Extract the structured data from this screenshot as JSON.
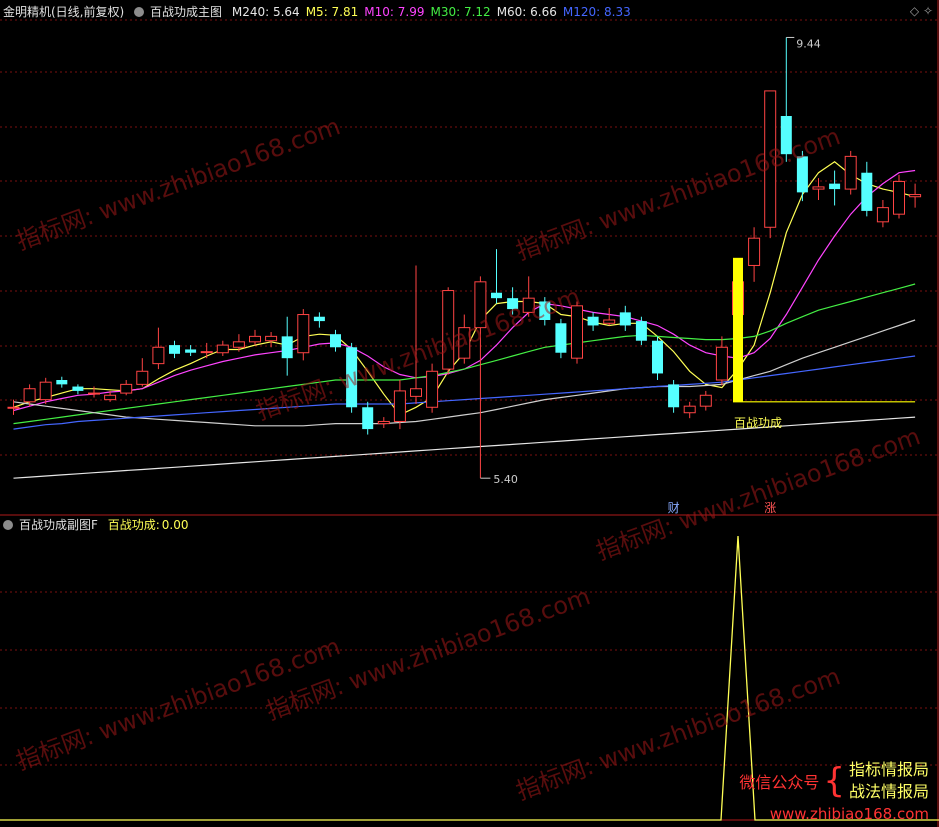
{
  "main_panel": {
    "title": "金明精机(日线,前复权)",
    "indicator_name": "百战功成主图",
    "ma_values": [
      {
        "label": "M240",
        "value": "5.64",
        "color": "#e6e6e6"
      },
      {
        "label": "M5",
        "value": "7.81",
        "color": "#ffff55"
      },
      {
        "label": "M10",
        "value": "7.99",
        "color": "#ff44ff"
      },
      {
        "label": "M30",
        "value": "7.12",
        "color": "#44ee44"
      },
      {
        "label": "M60",
        "value": "6.66",
        "color": "#e6e6e6"
      },
      {
        "label": "M120",
        "value": "8.33",
        "color": "#4466ff"
      }
    ],
    "high_label": "9.44",
    "low_label": "5.40",
    "signal_label": "百战功成",
    "marker_cai": "财",
    "marker_zhang": "涨"
  },
  "sub_panel": {
    "title": "百战功成副图F",
    "indicator_label": "百战功成:",
    "indicator_value": "0.00"
  },
  "watermark": {
    "domain_text": "www.zhibiao168.com",
    "brand_text": "指标网:"
  },
  "promo": {
    "wechat_label": "微信公众号",
    "line1": "指标情报局",
    "line2": "战法情报局",
    "url": "www.zhibiao168.com"
  },
  "colors": {
    "up": "#ff4444",
    "down": "#55ffff",
    "grid": "#7a1010",
    "signal_bar": "#ffff00"
  },
  "chart_data": {
    "type": "candlestick",
    "ylim": [
      5.2,
      9.6
    ],
    "candles": [
      {
        "o": 6.05,
        "c": 6.05,
        "h": 6.12,
        "l": 5.98
      },
      {
        "o": 6.1,
        "c": 6.22,
        "h": 6.26,
        "l": 6.06
      },
      {
        "o": 6.12,
        "c": 6.28,
        "h": 6.32,
        "l": 6.08
      },
      {
        "o": 6.3,
        "c": 6.26,
        "h": 6.33,
        "l": 6.23
      },
      {
        "o": 6.24,
        "c": 6.2,
        "h": 6.26,
        "l": 6.17
      },
      {
        "o": 6.18,
        "c": 6.18,
        "h": 6.24,
        "l": 6.14
      },
      {
        "o": 6.12,
        "c": 6.16,
        "h": 6.2,
        "l": 6.1
      },
      {
        "o": 6.18,
        "c": 6.26,
        "h": 6.3,
        "l": 6.16
      },
      {
        "o": 6.26,
        "c": 6.38,
        "h": 6.5,
        "l": 6.24
      },
      {
        "o": 6.45,
        "c": 6.6,
        "h": 6.78,
        "l": 6.4
      },
      {
        "o": 6.62,
        "c": 6.54,
        "h": 6.66,
        "l": 6.5
      },
      {
        "o": 6.58,
        "c": 6.55,
        "h": 6.62,
        "l": 6.52
      },
      {
        "o": 6.56,
        "c": 6.56,
        "h": 6.64,
        "l": 6.5
      },
      {
        "o": 6.55,
        "c": 6.62,
        "h": 6.66,
        "l": 6.52
      },
      {
        "o": 6.6,
        "c": 6.65,
        "h": 6.72,
        "l": 6.56
      },
      {
        "o": 6.65,
        "c": 6.7,
        "h": 6.76,
        "l": 6.62
      },
      {
        "o": 6.66,
        "c": 6.7,
        "h": 6.74,
        "l": 6.6
      },
      {
        "o": 6.7,
        "c": 6.5,
        "h": 6.88,
        "l": 6.34
      },
      {
        "o": 6.55,
        "c": 6.9,
        "h": 6.95,
        "l": 6.48
      },
      {
        "o": 6.88,
        "c": 6.84,
        "h": 6.92,
        "l": 6.78
      },
      {
        "o": 6.72,
        "c": 6.6,
        "h": 6.76,
        "l": 6.56
      },
      {
        "o": 6.6,
        "c": 6.05,
        "h": 6.64,
        "l": 6.0
      },
      {
        "o": 6.05,
        "c": 5.85,
        "h": 6.1,
        "l": 5.8
      },
      {
        "o": 5.9,
        "c": 5.92,
        "h": 5.96,
        "l": 5.86
      },
      {
        "o": 5.92,
        "c": 6.2,
        "h": 6.3,
        "l": 5.85
      },
      {
        "o": 6.15,
        "c": 6.22,
        "h": 7.35,
        "l": 6.08
      },
      {
        "o": 6.05,
        "c": 6.38,
        "h": 6.45,
        "l": 6.0
      },
      {
        "o": 6.4,
        "c": 7.12,
        "h": 7.15,
        "l": 6.35
      },
      {
        "o": 6.5,
        "c": 6.78,
        "h": 6.9,
        "l": 6.45
      },
      {
        "o": 6.78,
        "c": 7.2,
        "h": 7.25,
        "l": 5.4
      },
      {
        "o": 7.1,
        "c": 7.05,
        "h": 7.5,
        "l": 7.0
      },
      {
        "o": 7.05,
        "c": 6.95,
        "h": 7.15,
        "l": 6.9
      },
      {
        "o": 6.92,
        "c": 7.05,
        "h": 7.25,
        "l": 6.88
      },
      {
        "o": 7.02,
        "c": 6.85,
        "h": 7.06,
        "l": 6.8
      },
      {
        "o": 6.82,
        "c": 6.55,
        "h": 6.86,
        "l": 6.5
      },
      {
        "o": 6.5,
        "c": 6.98,
        "h": 7.02,
        "l": 6.45
      },
      {
        "o": 6.88,
        "c": 6.8,
        "h": 6.92,
        "l": 6.75
      },
      {
        "o": 6.82,
        "c": 6.85,
        "h": 6.96,
        "l": 6.8
      },
      {
        "o": 6.92,
        "c": 6.8,
        "h": 6.98,
        "l": 6.75
      },
      {
        "o": 6.84,
        "c": 6.66,
        "h": 6.88,
        "l": 6.62
      },
      {
        "o": 6.66,
        "c": 6.36,
        "h": 6.7,
        "l": 6.3
      },
      {
        "o": 6.26,
        "c": 6.05,
        "h": 6.3,
        "l": 6.0
      },
      {
        "o": 6.0,
        "c": 6.06,
        "h": 6.1,
        "l": 5.95
      },
      {
        "o": 6.06,
        "c": 6.16,
        "h": 6.2,
        "l": 6.02
      },
      {
        "o": 6.3,
        "c": 6.6,
        "h": 6.7,
        "l": 6.25
      },
      {
        "o": 6.9,
        "c": 7.2,
        "h": 7.3,
        "l": 6.85
      },
      {
        "o": 7.35,
        "c": 7.6,
        "h": 7.7,
        "l": 7.2
      },
      {
        "o": 7.7,
        "c": 8.95,
        "h": 8.95,
        "l": 7.6
      },
      {
        "o": 8.72,
        "c": 8.37,
        "h": 9.44,
        "l": 8.3
      },
      {
        "o": 8.35,
        "c": 8.02,
        "h": 8.4,
        "l": 7.94
      },
      {
        "o": 8.05,
        "c": 8.07,
        "h": 8.15,
        "l": 7.95
      },
      {
        "o": 8.1,
        "c": 8.05,
        "h": 8.22,
        "l": 7.9
      },
      {
        "o": 8.05,
        "c": 8.35,
        "h": 8.4,
        "l": 8.0
      },
      {
        "o": 8.2,
        "c": 7.85,
        "h": 8.3,
        "l": 7.8
      },
      {
        "o": 7.75,
        "c": 7.88,
        "h": 7.95,
        "l": 7.7
      },
      {
        "o": 7.82,
        "c": 8.12,
        "h": 8.18,
        "l": 7.78
      },
      {
        "o": 7.98,
        "c": 8.0,
        "h": 8.1,
        "l": 7.88
      }
    ],
    "ma_lines": {
      "M5": [
        6.05,
        6.1,
        6.14,
        6.18,
        6.22,
        6.22,
        6.21,
        6.2,
        6.22,
        6.31,
        6.39,
        6.45,
        6.52,
        6.58,
        6.58,
        6.62,
        6.65,
        6.62,
        6.7,
        6.72,
        6.71,
        6.58,
        6.38,
        6.17,
        5.98,
        6.05,
        6.14,
        6.38,
        6.55,
        6.85,
        7.0,
        7.02,
        7.02,
        7.0,
        6.9,
        6.88,
        6.83,
        6.8,
        6.82,
        6.82,
        6.7,
        6.56,
        6.38,
        6.26,
        6.23,
        6.4,
        6.62,
        7.1,
        7.65,
        8.0,
        8.2,
        8.3,
        8.18,
        8.1,
        8.05,
        8.02,
        7.98
      ],
      "M10": [
        6.02,
        6.06,
        6.1,
        6.13,
        6.16,
        6.17,
        6.19,
        6.2,
        6.22,
        6.28,
        6.34,
        6.39,
        6.43,
        6.47,
        6.5,
        6.53,
        6.55,
        6.57,
        6.6,
        6.63,
        6.64,
        6.6,
        6.52,
        6.42,
        6.35,
        6.32,
        6.33,
        6.36,
        6.4,
        6.48,
        6.62,
        6.78,
        6.92,
        7.0,
        6.98,
        6.95,
        6.92,
        6.9,
        6.88,
        6.84,
        6.8,
        6.72,
        6.62,
        6.55,
        6.52,
        6.5,
        6.55,
        6.68,
        6.9,
        7.15,
        7.4,
        7.62,
        7.82,
        7.98,
        8.1,
        8.2,
        8.22
      ],
      "M30": [
        5.9,
        5.92,
        5.94,
        5.96,
        5.98,
        6.0,
        6.02,
        6.04,
        6.06,
        6.08,
        6.1,
        6.12,
        6.14,
        6.16,
        6.18,
        6.2,
        6.22,
        6.24,
        6.26,
        6.28,
        6.3,
        6.3,
        6.3,
        6.3,
        6.3,
        6.32,
        6.34,
        6.37,
        6.4,
        6.44,
        6.48,
        6.52,
        6.56,
        6.6,
        6.62,
        6.64,
        6.66,
        6.68,
        6.7,
        6.71,
        6.7,
        6.69,
        6.68,
        6.67,
        6.67,
        6.68,
        6.7,
        6.75,
        6.82,
        6.88,
        6.94,
        6.98,
        7.02,
        7.06,
        7.1,
        7.14,
        7.18
      ],
      "M60": [
        6.1,
        6.08,
        6.06,
        6.04,
        6.02,
        6.0,
        5.98,
        5.96,
        5.95,
        5.94,
        5.93,
        5.92,
        5.91,
        5.9,
        5.89,
        5.88,
        5.88,
        5.88,
        5.88,
        5.89,
        5.9,
        5.9,
        5.9,
        5.9,
        5.91,
        5.92,
        5.94,
        5.96,
        5.98,
        6.0,
        6.03,
        6.06,
        6.09,
        6.12,
        6.14,
        6.16,
        6.18,
        6.2,
        6.22,
        6.23,
        6.24,
        6.24,
        6.24,
        6.25,
        6.26,
        6.3,
        6.34,
        6.38,
        6.44,
        6.5,
        6.55,
        6.6,
        6.65,
        6.7,
        6.75,
        6.8,
        6.85
      ],
      "M120": [
        5.85,
        5.87,
        5.89,
        5.9,
        5.92,
        5.93,
        5.94,
        5.95,
        5.96,
        5.97,
        5.98,
        5.99,
        6.0,
        6.01,
        6.02,
        6.03,
        6.04,
        6.05,
        6.06,
        6.07,
        6.08,
        6.08,
        6.08,
        6.08,
        6.08,
        6.09,
        6.1,
        6.11,
        6.12,
        6.13,
        6.14,
        6.15,
        6.16,
        6.17,
        6.18,
        6.19,
        6.2,
        6.21,
        6.22,
        6.23,
        6.24,
        6.25,
        6.26,
        6.27,
        6.28,
        6.3,
        6.32,
        6.34,
        6.36,
        6.38,
        6.4,
        6.42,
        6.44,
        6.46,
        6.48,
        6.5,
        6.52
      ],
      "M240": [
        5.4,
        5.41,
        5.42,
        5.43,
        5.44,
        5.45,
        5.46,
        5.47,
        5.48,
        5.49,
        5.5,
        5.51,
        5.52,
        5.53,
        5.54,
        5.55,
        5.56,
        5.57,
        5.58,
        5.59,
        5.6,
        5.61,
        5.62,
        5.63,
        5.64,
        5.65,
        5.66,
        5.67,
        5.68,
        5.69,
        5.7,
        5.71,
        5.72,
        5.73,
        5.74,
        5.75,
        5.76,
        5.77,
        5.78,
        5.79,
        5.8,
        5.81,
        5.82,
        5.83,
        5.84,
        5.85,
        5.86,
        5.87,
        5.88,
        5.89,
        5.9,
        5.91,
        5.92,
        5.93,
        5.94,
        5.95,
        5.96
      ]
    },
    "signal": {
      "index": 45,
      "level": 6.1
    },
    "sub_series": {
      "peak_index": 45,
      "peak_value": 1.0
    }
  }
}
